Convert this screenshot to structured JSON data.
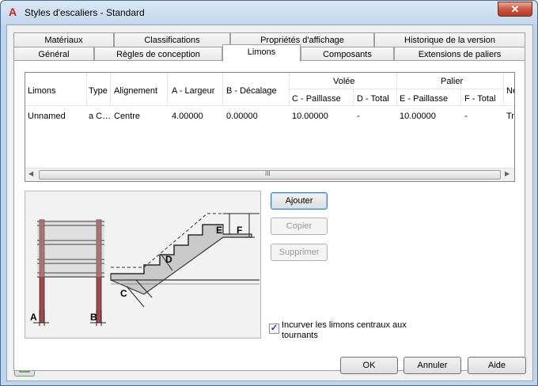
{
  "window": {
    "title": "Styles d'escaliers - Standard",
    "app_icon": "A",
    "close_glyph": "✕"
  },
  "tabs_row1": [
    {
      "label": "Matériaux"
    },
    {
      "label": "Classifications"
    },
    {
      "label": "Propriétés d'affichage"
    },
    {
      "label": "Historique de la version"
    }
  ],
  "tabs_row2": [
    {
      "label": "Général"
    },
    {
      "label": "Règles de conception"
    },
    {
      "label": "Limons",
      "active": true
    },
    {
      "label": "Composants"
    },
    {
      "label": "Extensions de paliers"
    }
  ],
  "table": {
    "group_headers": {
      "flight": "Volée",
      "landing": "Palier"
    },
    "columns": [
      "Limons",
      "Type",
      "Alignement",
      "A - Largeur",
      "B - Décalage",
      "C - Paillasse",
      "D - Total",
      "E - Paillasse",
      "F - Total",
      "Ne"
    ],
    "rows": [
      [
        "Unnamed",
        "a C…",
        "Centre",
        "4.00000",
        "0.00000",
        "10.00000",
        "-",
        "10.00000",
        "-",
        "Tro"
      ]
    ],
    "scroll_grip": "III"
  },
  "illustration": {
    "labels": {
      "a": "A",
      "b": "B",
      "c": "C",
      "d": "D",
      "e": "E",
      "f": "F"
    }
  },
  "buttons": {
    "add": "Ajouter",
    "copy": "Copier",
    "delete": "Supprimer",
    "ok": "OK",
    "cancel": "Annuler",
    "help": "Aide"
  },
  "checkbox": {
    "label": "Incurver les limons centraux aux tournants",
    "checked": true
  },
  "icons": [
    "close-icon",
    "autocad-logo-icon",
    "details-icon"
  ]
}
